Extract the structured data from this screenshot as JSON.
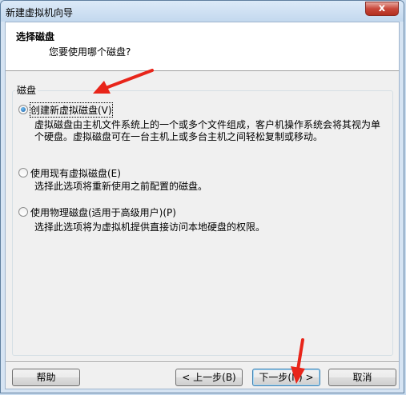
{
  "window": {
    "title": "新建虚拟机向导",
    "close_glyph": "x"
  },
  "header": {
    "title": "选择磁盘",
    "subtitle": "您要使用哪个磁盘?"
  },
  "group": {
    "label": "磁盘"
  },
  "options": [
    {
      "label": "创建新虚拟磁盘(V)",
      "selected": true,
      "description_lines": [
        "虚拟磁盘由主机文件系统上的一个或多个文件组成，客户机操作系统会将其视为单",
        "个硬盘。虚拟磁盘可在一台主机上或多台主机之间轻松复制或移动。"
      ]
    },
    {
      "label": "使用现有虚拟磁盘(E)",
      "selected": false,
      "description_lines": [
        "选择此选项将重新使用之前配置的磁盘。"
      ]
    },
    {
      "label": "使用物理磁盘(适用于高级用户)(P)",
      "selected": false,
      "description_lines": [
        "选择此选项将为虚拟机提供直接访问本地硬盘的权限。"
      ]
    }
  ],
  "buttons": {
    "help": "帮助",
    "back": "< 上一步(B)",
    "next": "下一步(N) >",
    "cancel": "取消"
  },
  "annotation_color": "#e8251a"
}
